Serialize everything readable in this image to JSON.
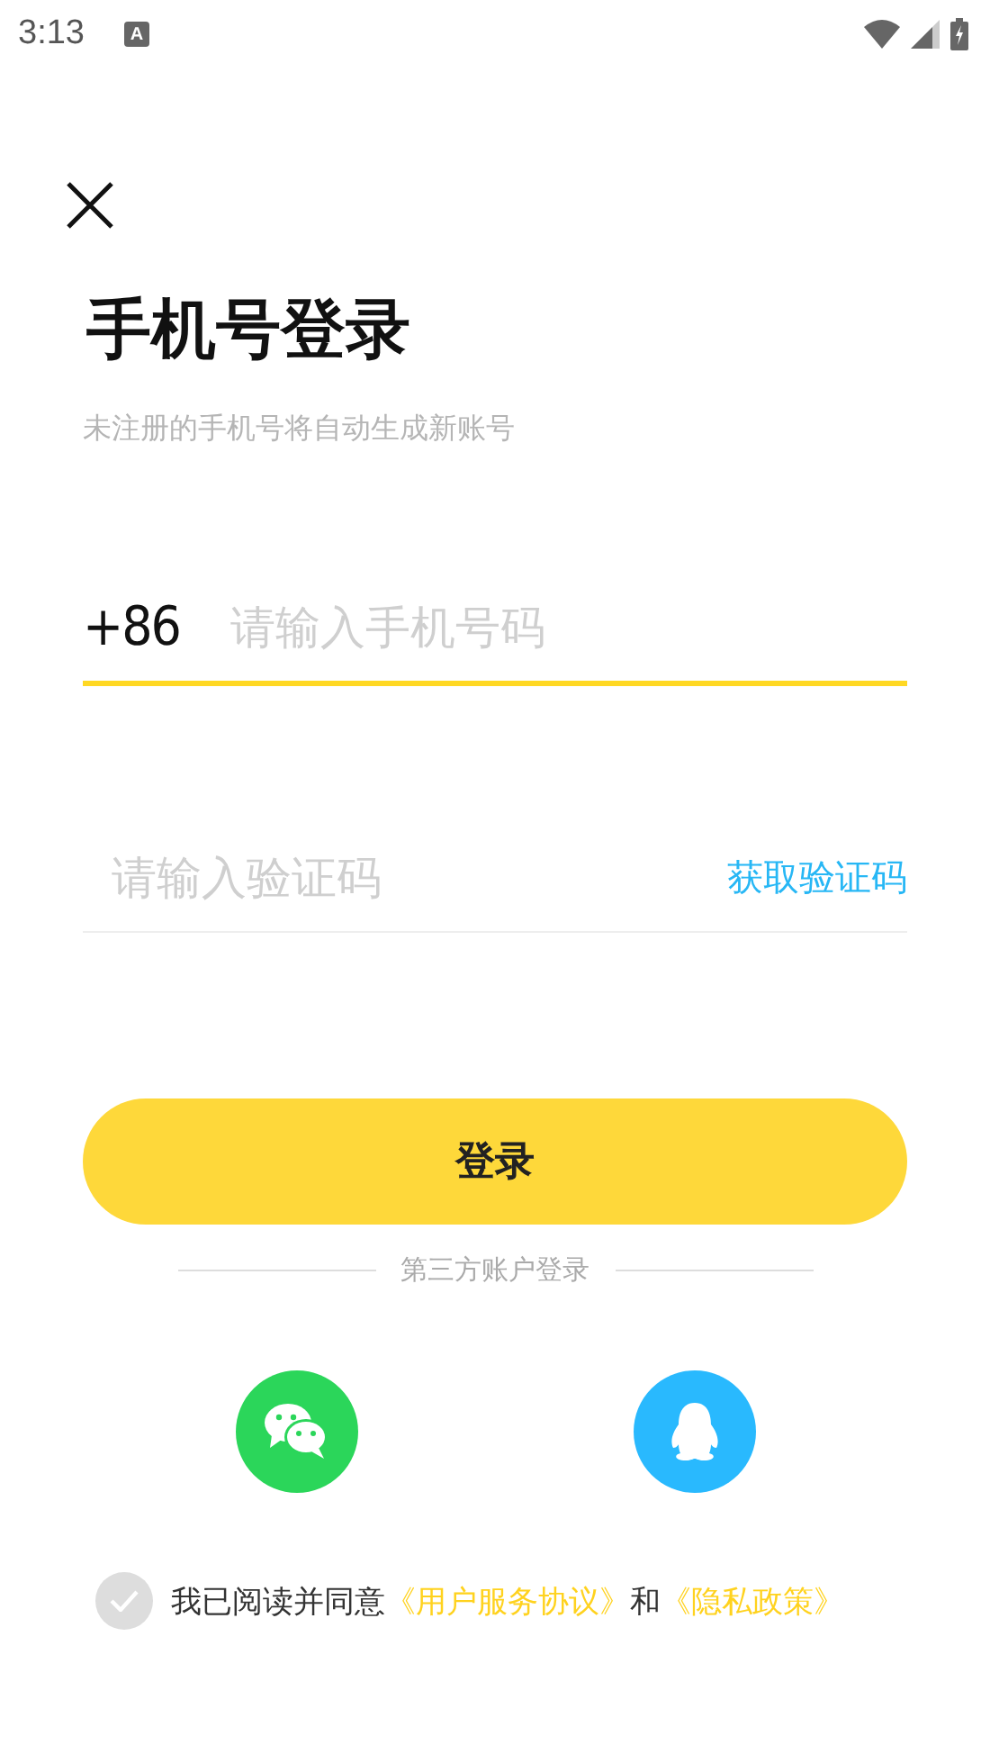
{
  "status_bar": {
    "time": "3:13",
    "notification_icon": "A"
  },
  "title": "手机号登录",
  "subtitle": "未注册的手机号将自动生成新账号",
  "phone": {
    "prefix": "+86",
    "placeholder": "请输入手机号码",
    "focused": true
  },
  "code": {
    "placeholder": "请输入验证码",
    "action": "获取验证码",
    "focused": false
  },
  "login_button": "登录",
  "third_party_label": "第三方账户登录",
  "social_logins": [
    {
      "kind": "chat",
      "color": "#2bd65a"
    },
    {
      "kind": "penguin",
      "color": "#29b9fe"
    }
  ],
  "agreement": {
    "checked": false,
    "text": "我已阅读并同意",
    "link_1": "《用户服务协议》",
    "joiner": "和",
    "link_2": "《隐私政策》"
  }
}
